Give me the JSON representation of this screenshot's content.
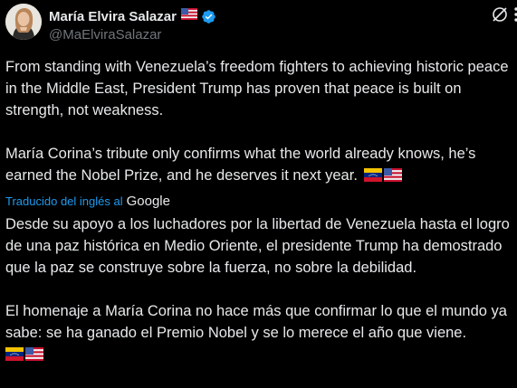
{
  "author": {
    "display_name": "María Elvira Salazar",
    "handle": "@MaElviraSalazar",
    "flag_icon": "us-flag-icon",
    "verified_color": "#1d9bf0"
  },
  "tweet": {
    "original": {
      "paragraph1": "From standing with Venezuela’s freedom fighters to achieving historic peace in the Middle East, President Trump has proven that peace is built on strength, not weakness.",
      "paragraph2": "María Corina’s tribute only confirms what the world already knows, he’s earned the Nobel Prize, and he deserves it next year."
    },
    "translation_label": "Traducido del inglés al",
    "translation_provider": "Google",
    "translation": {
      "paragraph1": "Desde su apoyo a los luchadores por la libertad de Venezuela hasta el logro de una paz histórica en Medio Oriente, el presidente Trump ha demostrado que la paz se construye sobre la fuerza, no sobre la debilidad.",
      "paragraph2": "El homenaje a María Corina no hace más que confirmar lo que el mundo ya sabe: se ha ganado el Premio Nobel y se lo merece el año que viene."
    }
  },
  "colors": {
    "background": "#000000",
    "text": "#e7e9ea",
    "secondary": "#71767b",
    "link": "#1d9bf0"
  }
}
